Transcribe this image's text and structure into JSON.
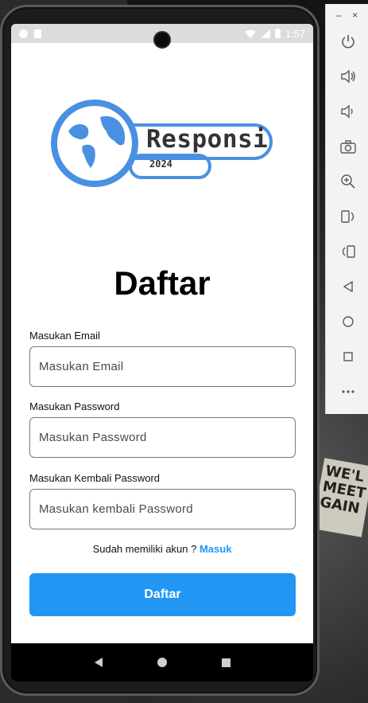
{
  "status_bar": {
    "time": "1:57"
  },
  "app": {
    "logo": {
      "word": "Responsi",
      "year": "2024"
    },
    "title": "Daftar",
    "fields": [
      {
        "label": "Masukan Email",
        "placeholder": "Masukan Email"
      },
      {
        "label": "Masukan Password",
        "placeholder": "Masukan Password"
      },
      {
        "label": "Masukan Kembali Password",
        "placeholder": "Masukan kembali Password"
      }
    ],
    "login_prompt": "Sudah memiliki akun ? ",
    "login_link": "Masuk",
    "submit_label": "Daftar"
  },
  "colors": {
    "accent": "#2196f3",
    "logo_blue": "#4a90e2"
  },
  "background": {
    "sign_text": "WE'L MEET GAIN"
  },
  "emulator_toolbar": {
    "minimize": "–",
    "close": "×",
    "buttons": [
      "power-icon",
      "volume-up-icon",
      "volume-down-icon",
      "camera-icon",
      "zoom-in-icon",
      "rotate-left-icon",
      "rotate-right-icon",
      "back-icon",
      "home-icon",
      "overview-icon",
      "more-icon"
    ]
  }
}
